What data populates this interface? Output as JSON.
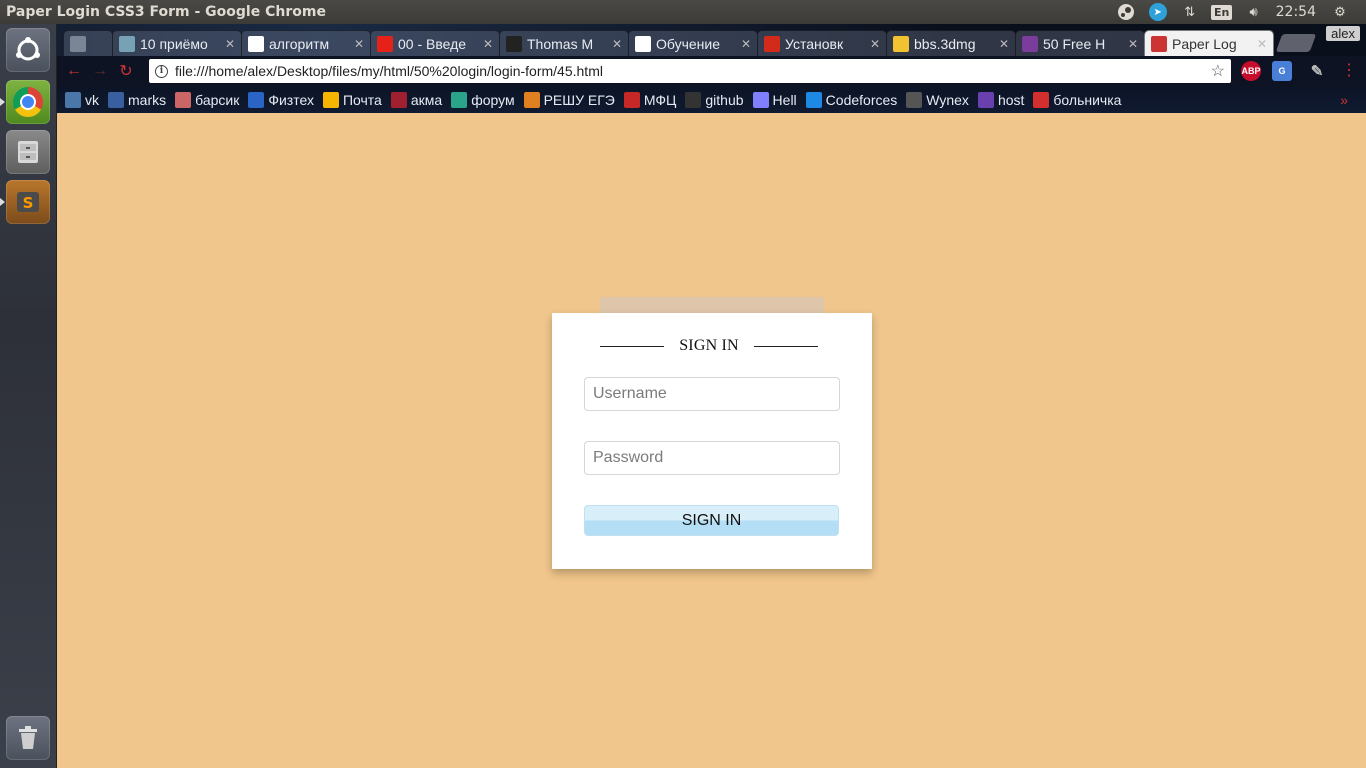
{
  "os": {
    "window_title": "Paper Login CSS3 Form - Google Chrome",
    "tray": {
      "language": "En",
      "clock": "22:54"
    },
    "launcher": [
      {
        "name": "dash"
      },
      {
        "name": "chrome"
      },
      {
        "name": "files"
      },
      {
        "name": "sublime-text"
      },
      {
        "name": "trash"
      }
    ]
  },
  "browser": {
    "profile": "alex",
    "tabs": [
      {
        "title": "",
        "favicon": "speaker-icon",
        "color": "#7a8595"
      },
      {
        "title": "10 приёмо",
        "favicon": "habr-icon",
        "color": "#77a2b6"
      },
      {
        "title": "алгоритм",
        "favicon": "google-icon",
        "color": "#ffffff"
      },
      {
        "title": "00 - Введе",
        "favicon": "youtube-icon",
        "color": "#e62117"
      },
      {
        "title": "Thomas M",
        "favicon": "thomas-icon",
        "color": "#222222"
      },
      {
        "title": "Обучение",
        "favicon": "t-icon",
        "color": "#ffffff"
      },
      {
        "title": "Установк",
        "favicon": "apple-icon",
        "color": "#d42a1b"
      },
      {
        "title": "bbs.3dmg",
        "favicon": "bbs-icon",
        "color": "#f2c230"
      },
      {
        "title": "50 Free H",
        "favicon": "colorlib-icon",
        "color": "#7a3d9c"
      },
      {
        "title": "Paper Log",
        "favicon": "page-icon",
        "color": "#cc3333",
        "active": true
      }
    ],
    "url": "file:///home/alex/Desktop/files/my/html/50%20login/login-form/45.html",
    "extensions": {
      "abp": "ABP"
    },
    "bookmarks": [
      {
        "label": "vk",
        "color": "#4a76a8"
      },
      {
        "label": "marks",
        "color": "#3a5fa0"
      },
      {
        "label": "барсик",
        "color": "#c66"
      },
      {
        "label": "Физтех",
        "color": "#2a64c4"
      },
      {
        "label": "Почта",
        "color": "#f7b500"
      },
      {
        "label": "акма",
        "color": "#a02030"
      },
      {
        "label": "форум",
        "color": "#2aa58a"
      },
      {
        "label": "РЕШУ ЕГЭ",
        "color": "#e08020"
      },
      {
        "label": "МФЦ",
        "color": "#c62828"
      },
      {
        "label": "github",
        "color": "#333333"
      },
      {
        "label": "Hell",
        "color": "#8080ff"
      },
      {
        "label": "Codeforces",
        "color": "#1e88e5"
      },
      {
        "label": "Wynex",
        "color": "#555555"
      },
      {
        "label": "host",
        "color": "#6a3fb0"
      },
      {
        "label": "больничка",
        "color": "#d32f2f"
      }
    ]
  },
  "form": {
    "title": "SIGN IN",
    "username_placeholder": "Username",
    "password_placeholder": "Password",
    "submit_label": "SIGN IN"
  },
  "colors": {
    "page_background": "#f0c68c",
    "paper_stack": "#dfc6ab",
    "button_light": "#d8eef9",
    "button_dark": "#b4def5"
  }
}
